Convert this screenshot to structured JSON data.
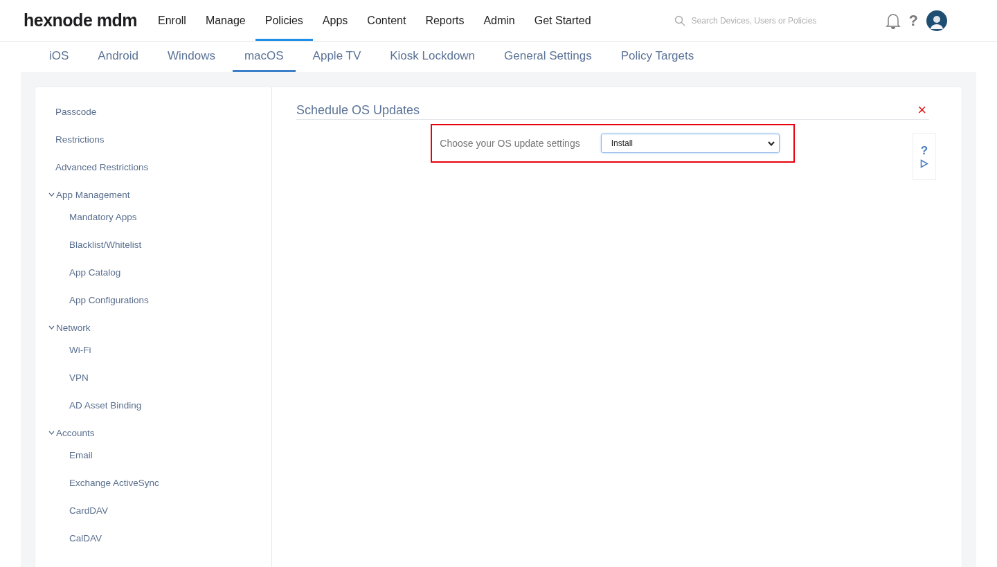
{
  "header": {
    "logo": "hexnode mdm",
    "nav": [
      {
        "label": "Enroll",
        "selected": false
      },
      {
        "label": "Manage",
        "selected": false
      },
      {
        "label": "Policies",
        "selected": true
      },
      {
        "label": "Apps",
        "selected": false
      },
      {
        "label": "Content",
        "selected": false
      },
      {
        "label": "Reports",
        "selected": false
      },
      {
        "label": "Admin",
        "selected": false
      },
      {
        "label": "Get Started",
        "selected": false
      }
    ],
    "search": {
      "placeholder": "Search Devices, Users or Policies"
    },
    "help": "?"
  },
  "platform_tabs": [
    {
      "label": "iOS",
      "selected": false
    },
    {
      "label": "Android",
      "selected": false
    },
    {
      "label": "Windows",
      "selected": false
    },
    {
      "label": "macOS",
      "selected": true
    },
    {
      "label": "Apple TV",
      "selected": false
    },
    {
      "label": "Kiosk Lockdown",
      "selected": false
    },
    {
      "label": "General Settings",
      "selected": false
    },
    {
      "label": "Policy Targets",
      "selected": false
    }
  ],
  "sidebar": {
    "items": [
      {
        "label": "Passcode"
      },
      {
        "label": "Restrictions"
      },
      {
        "label": "Advanced Restrictions"
      },
      {
        "label": "App Management",
        "expanded": true,
        "children": [
          {
            "label": "Mandatory Apps"
          },
          {
            "label": "Blacklist/Whitelist"
          },
          {
            "label": "App Catalog"
          },
          {
            "label": "App Configurations"
          }
        ]
      },
      {
        "label": "Network",
        "expanded": true,
        "children": [
          {
            "label": "Wi-Fi"
          },
          {
            "label": "VPN"
          },
          {
            "label": "AD Asset Binding"
          }
        ]
      },
      {
        "label": "Accounts",
        "expanded": true,
        "children": [
          {
            "label": "Email"
          },
          {
            "label": "Exchange ActiveSync"
          },
          {
            "label": "CardDAV"
          },
          {
            "label": "CalDAV"
          }
        ]
      }
    ]
  },
  "section": {
    "title": "Schedule OS Updates",
    "close": "×",
    "field": {
      "label": "Choose your OS update settings",
      "value": "Install",
      "highlighted": true
    },
    "side_help": "?"
  }
}
